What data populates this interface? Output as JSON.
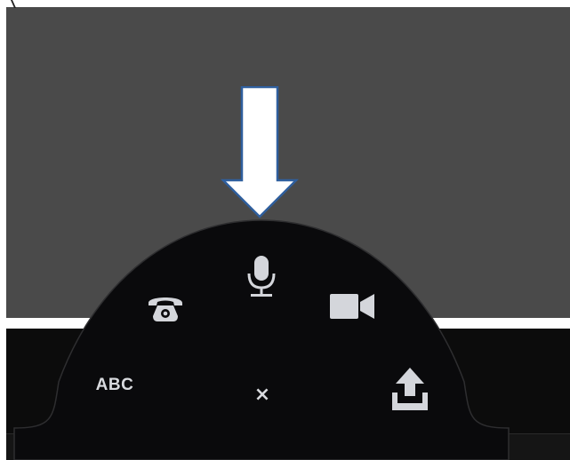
{
  "menu": {
    "items": [
      {
        "id": "phone",
        "icon": "phone-icon"
      },
      {
        "id": "microphone",
        "icon": "microphone-icon"
      },
      {
        "id": "video",
        "icon": "video-camera-icon"
      },
      {
        "id": "keyboard",
        "label": "ABC"
      },
      {
        "id": "close",
        "label": "×"
      },
      {
        "id": "upload",
        "icon": "upload-icon"
      }
    ]
  },
  "colors": {
    "background": "#4a4a4a",
    "bar": "#0c0c0c",
    "menu": "#0a0a0c",
    "icon": "#d4d6db",
    "arrow_fill": "#ffffff",
    "arrow_stroke": "#2f5f9e"
  }
}
